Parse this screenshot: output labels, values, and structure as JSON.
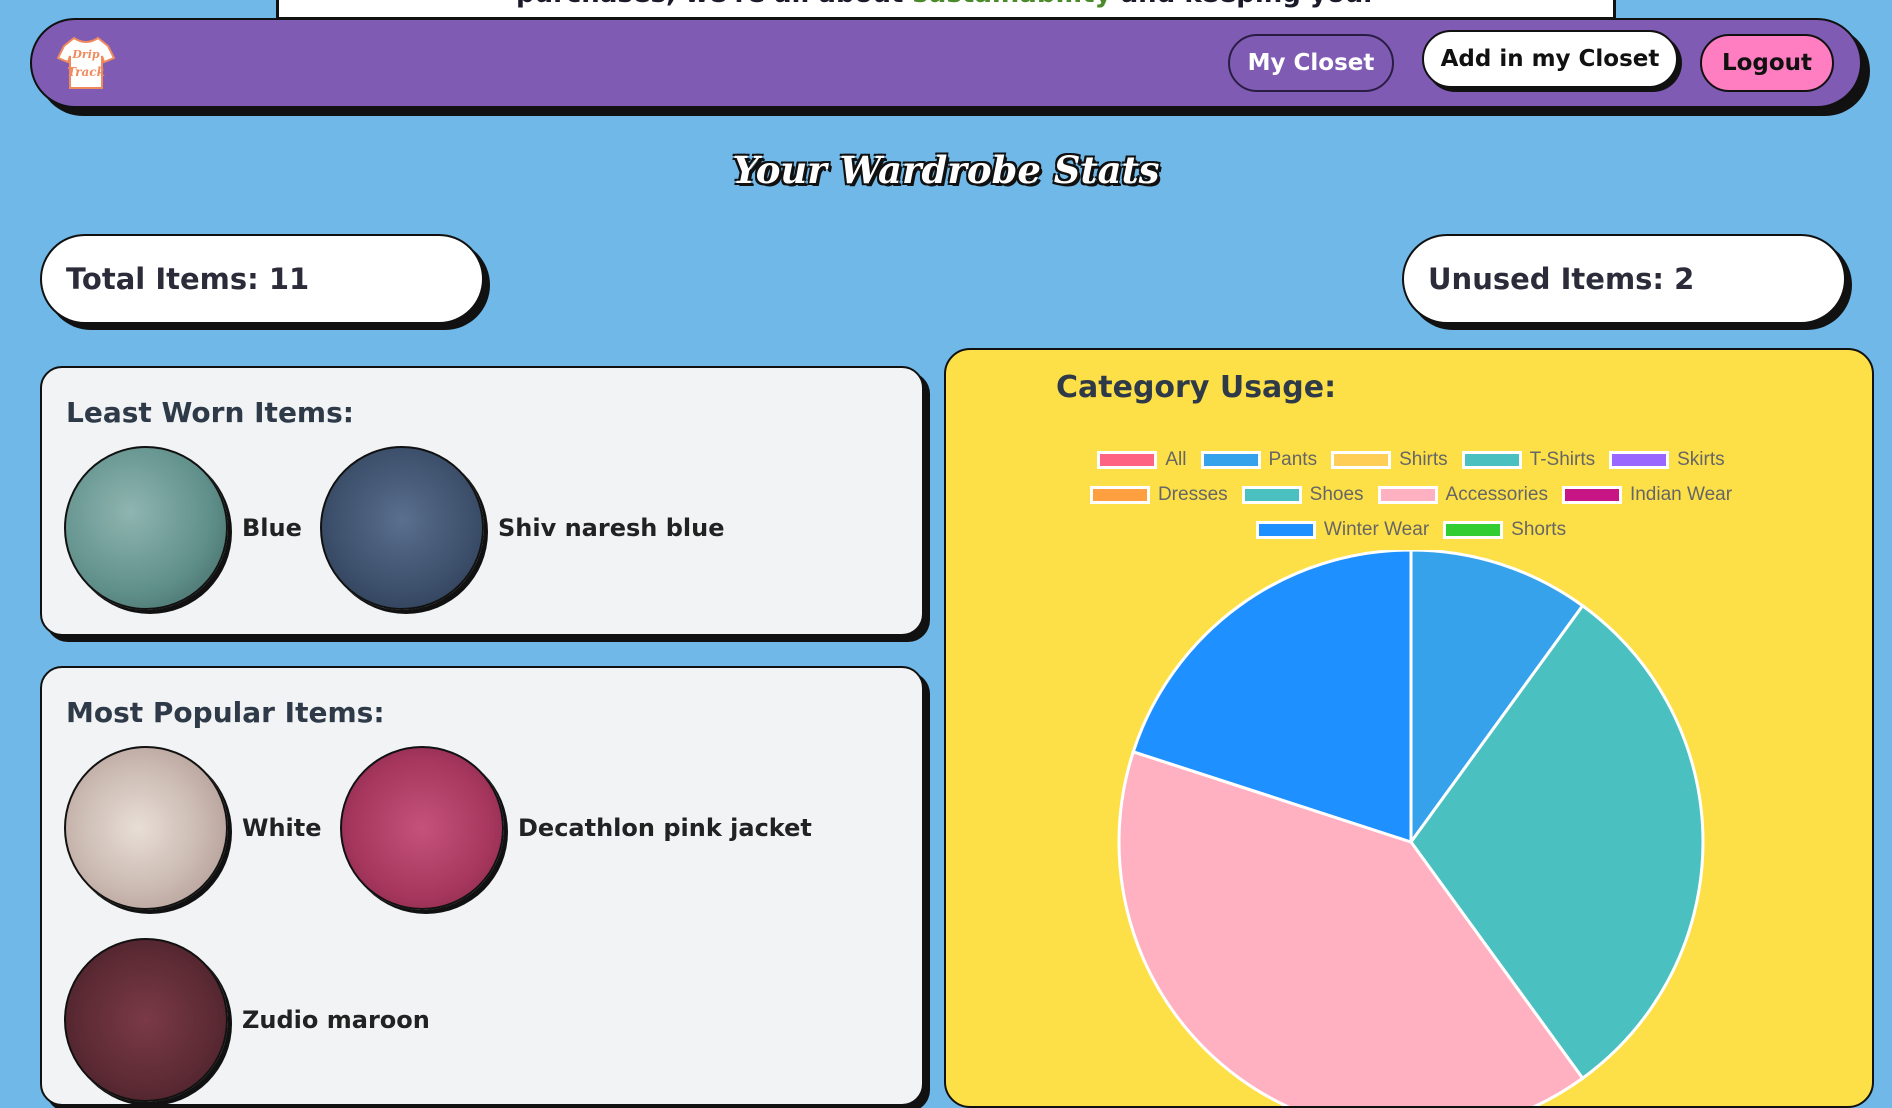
{
  "behind": {
    "text_before": "purchases, we're all about ",
    "accent": "sustainability",
    "text_after": " and keeping your"
  },
  "navbar": {
    "logo_text": "Drip Track",
    "my_closet": "My Closet",
    "add_in_closet": "Add in my Closet",
    "logout": "Logout"
  },
  "page": {
    "title": "Your Wardrobe Stats"
  },
  "stats": {
    "total": "Total Items: 11",
    "unused": "Unused Items: 2"
  },
  "least_worn": {
    "heading": "Least Worn Items:",
    "items": [
      {
        "label": "Blue",
        "color": "#5f8f8a"
      },
      {
        "label": "Shiv naresh blue",
        "color": "#3c4f6b"
      }
    ]
  },
  "most_popular": {
    "heading": "Most Popular Items:",
    "items": [
      {
        "label": "White",
        "color": "#c9b8b0"
      },
      {
        "label": "Decathlon pink jacket",
        "color": "#a8375e"
      },
      {
        "label": "Zudio maroon",
        "color": "#5c2a34"
      }
    ]
  },
  "chart": {
    "title": "Category Usage:"
  },
  "chart_data": {
    "type": "pie",
    "categories": [
      "All",
      "Pants",
      "Shirts",
      "T-Shirts",
      "Skirts",
      "Dresses",
      "Shoes",
      "Accessories",
      "Indian Wear",
      "Winter Wear",
      "Shorts"
    ],
    "colors": [
      "#ff6384",
      "#36a2eb",
      "#ffce56",
      "#4bc0c0",
      "#9966ff",
      "#ff9f40",
      "#4bc0c0",
      "#ffb1c1",
      "#c71585",
      "#1e90ff",
      "#32cd32"
    ],
    "values": [
      0,
      1,
      0,
      3,
      0,
      0,
      0,
      4,
      0,
      2,
      0
    ]
  }
}
